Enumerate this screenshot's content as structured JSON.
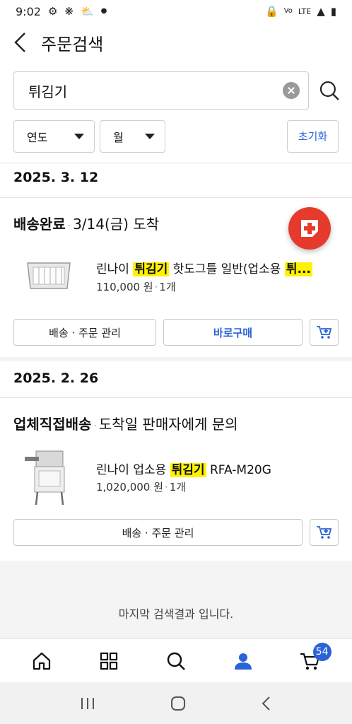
{
  "status_bar": {
    "time": "9:02",
    "network": "LTE"
  },
  "header": {
    "title": "주문검색"
  },
  "search": {
    "value": "튀김기"
  },
  "filters": {
    "year_label": "연도",
    "month_label": "월",
    "reset_label": "초기화"
  },
  "orders": [
    {
      "date": "2025. 3. 12",
      "status": "배송완료",
      "status_sep": "·",
      "status_detail": "3/14(금) 도착",
      "product": {
        "name_before": "린나이 ",
        "name_highlight": "튀김기",
        "name_after": " 핫도그틀 일반(업소용 ",
        "name_tail_highlight": "튀...",
        "price": "110,000 원",
        "meta_sep": "·",
        "quantity": "1개"
      },
      "buttons": {
        "manage": "배송 · 주문 관리",
        "buy_again": "바로구매"
      }
    },
    {
      "date": "2025. 2. 26",
      "status": "업체직접배송",
      "status_sep": "·",
      "status_detail": "도착일 판매자에게 문의",
      "product": {
        "name_before": "린나이 업소용 ",
        "name_highlight": "튀김기",
        "name_after": " RFA-M20G",
        "price": "1,020,000 원",
        "meta_sep": "·",
        "quantity": "1개"
      },
      "buttons": {
        "manage": "배송 · 주문 관리"
      }
    }
  ],
  "end_message": "마지막 검색결과 입니다.",
  "tab_bar": {
    "cart_badge": "54"
  },
  "colors": {
    "accent": "#2a62d8",
    "highlight": "#fff200",
    "fab": "#e53a2c"
  }
}
